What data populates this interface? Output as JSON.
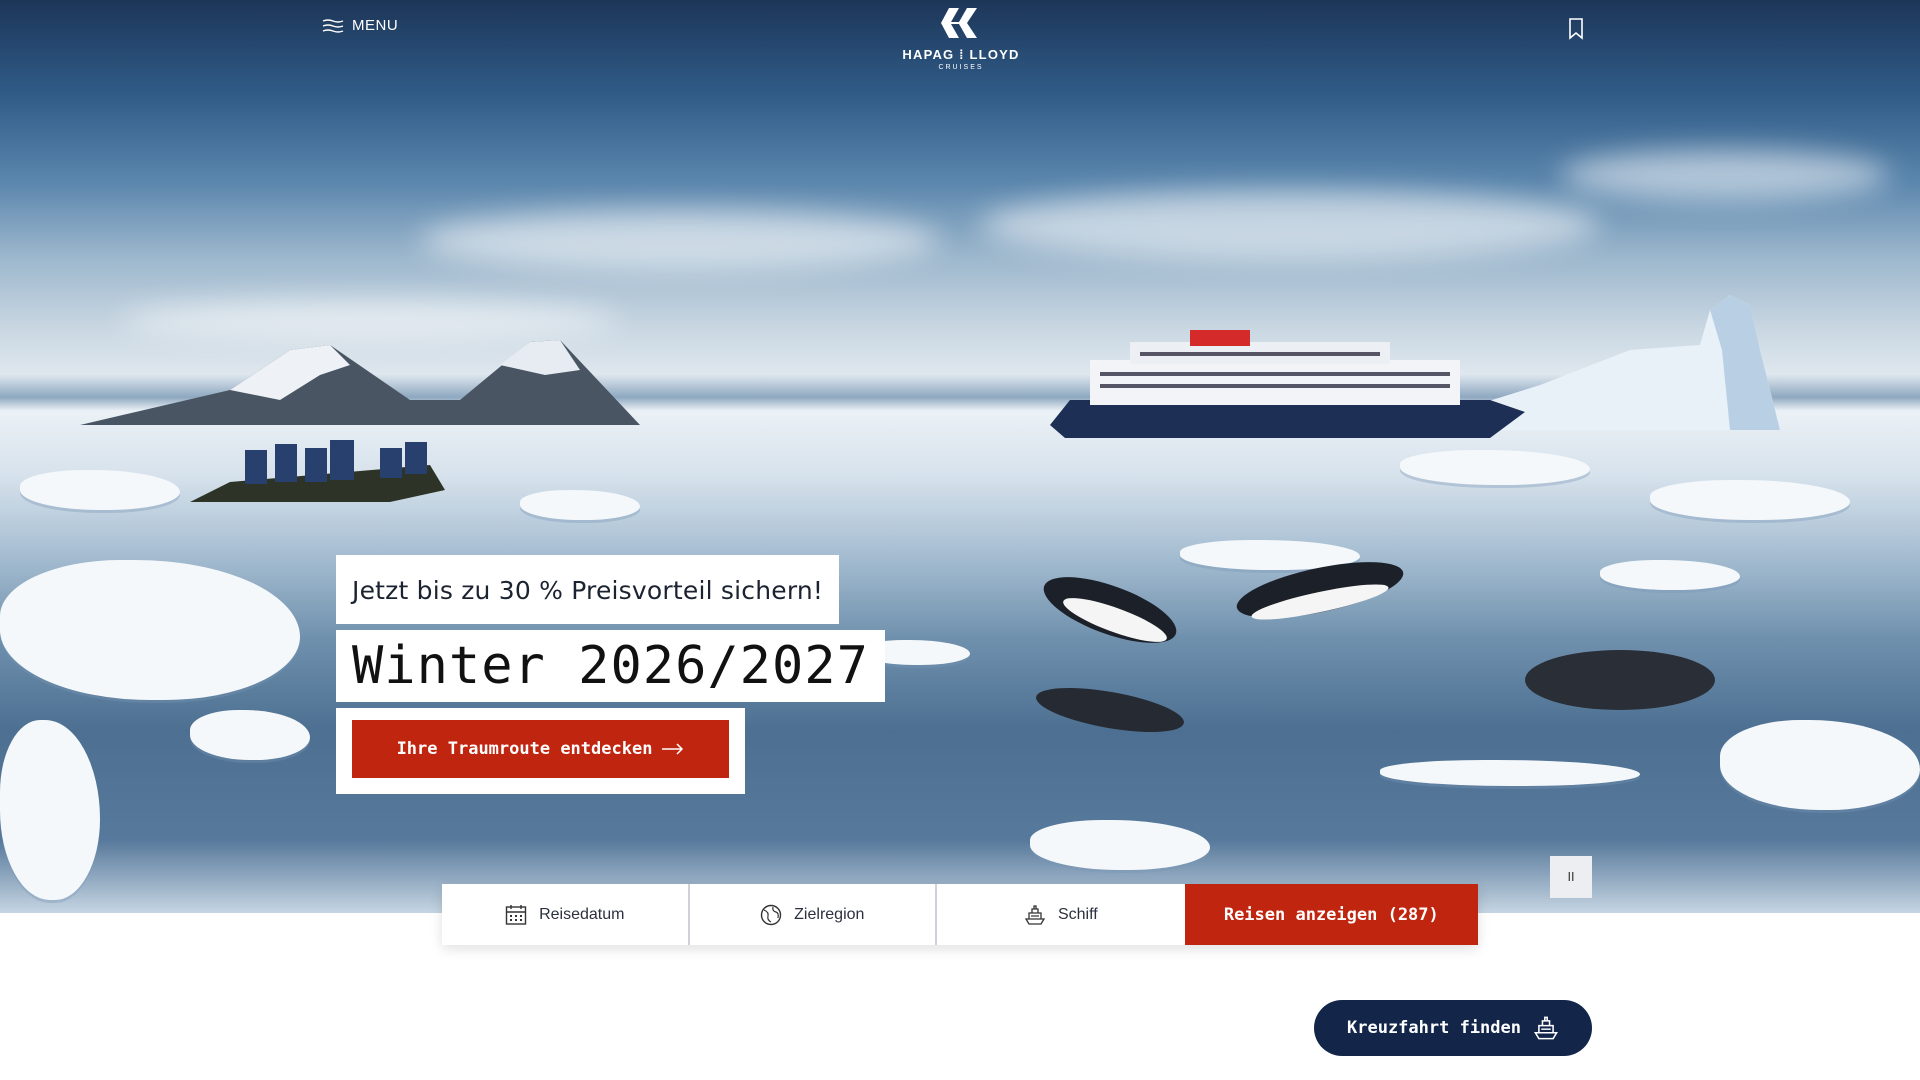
{
  "nav": {
    "menu_label": "MENU",
    "logo_name_left": "HAPAG",
    "logo_name_right": "LLOYD",
    "logo_sub": "CRUISES"
  },
  "hero": {
    "promo_text": "Jetzt bis zu 30 % Preisvorteil sichern!",
    "title": "Winter 2026/2027",
    "cta_label": "Ihre Traumroute entdecken",
    "pause_label": "II"
  },
  "search": {
    "fields": [
      {
        "label": "Reisedatum",
        "icon": "calendar-icon"
      },
      {
        "label": "Zielregion",
        "icon": "globe-icon"
      },
      {
        "label": "Schiff",
        "icon": "ship-icon"
      }
    ],
    "show_button": "Reisen anzeigen (287)"
  },
  "floating": {
    "find_button": "Kreuzfahrt finden",
    "find_icon": "ship-icon"
  },
  "colors": {
    "accent_red": "#c0250f",
    "navy": "#13264a"
  }
}
